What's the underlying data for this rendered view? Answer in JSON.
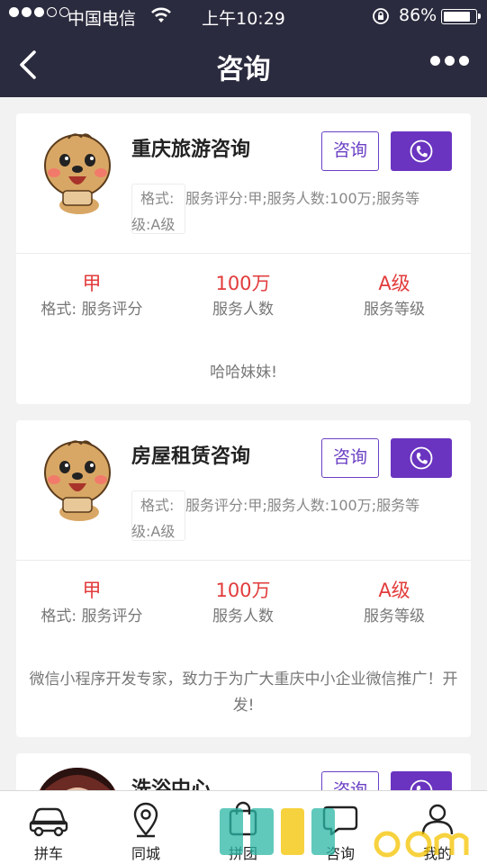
{
  "status_bar": {
    "carrier": "中国电信",
    "time": "上午10:29",
    "battery": "86%",
    "battery_level": 0.86,
    "signal_bars": 3,
    "signal_total": 5
  },
  "nav": {
    "title": "咨询",
    "back_icon": "chevron-left-icon",
    "more_icon": "more-dots-icon"
  },
  "cards": [
    {
      "name": "重庆旅游咨询",
      "consult_label": "咨询",
      "call_icon": "phone-icon",
      "format_label": "格式:",
      "description": "服务评分:甲;服务人数:100万;服务等级:A级",
      "stats": [
        {
          "value": "甲",
          "label": "格式: 服务评分"
        },
        {
          "value": "100万",
          "label": "服务人数"
        },
        {
          "value": "A级",
          "label": "服务等级"
        }
      ],
      "footer": "哈哈妹妹!"
    },
    {
      "name": "房屋租赁咨询",
      "consult_label": "咨询",
      "call_icon": "phone-icon",
      "format_label": "格式:",
      "description": "服务评分:甲;服务人数:100万;服务等级:A级",
      "stats": [
        {
          "value": "甲",
          "label": "格式: 服务评分"
        },
        {
          "value": "100万",
          "label": "服务人数"
        },
        {
          "value": "A级",
          "label": "服务等级"
        }
      ],
      "footer": "微信小程序开发专家，致力于为广大重庆中小企业微信推广！开发!"
    },
    {
      "name": "洗浴中心",
      "consult_label": "咨询",
      "call_icon": "phone-icon"
    }
  ],
  "tabs": [
    {
      "label": "拼车",
      "icon": "car-icon"
    },
    {
      "label": "同城",
      "icon": "location-pin-icon"
    },
    {
      "label": "拼团",
      "icon": "shopping-bag-icon"
    },
    {
      "label": "咨询",
      "icon": "chat-icon"
    },
    {
      "label": "我的",
      "icon": "user-icon"
    }
  ],
  "colors": {
    "header_bg": "#2b2b3f",
    "accent": "#6a34c0",
    "stat_value": "#e23b3b"
  }
}
